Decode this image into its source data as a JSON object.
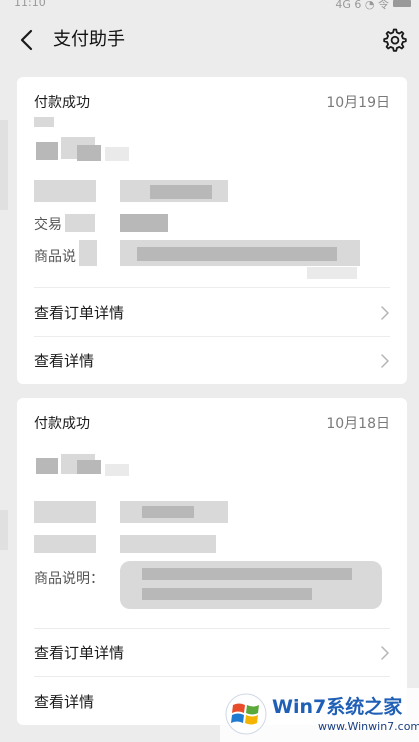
{
  "status_bar": {
    "time": "11:10",
    "indicators": "4G 6 ◔ 令"
  },
  "header": {
    "title": "支付助手"
  },
  "cards": [
    {
      "status": "付款成功",
      "date": "10月19日",
      "labels": {
        "transaction": "交易",
        "product": "商品说"
      },
      "rows": [
        {
          "label": "查看订单详情"
        },
        {
          "label": "查看详情"
        }
      ]
    },
    {
      "status": "付款成功",
      "date": "10月18日",
      "labels": {
        "product": "商品说明："
      },
      "rows": [
        {
          "label": "查看订单详情"
        },
        {
          "label": "查看详情"
        }
      ]
    }
  ],
  "watermark": {
    "title": "Win7系统之家",
    "url": "www.Winwin7.com"
  },
  "icons": {
    "back": "back-arrow-icon",
    "settings": "gear-icon",
    "chevron": "chevron-right-icon",
    "watermark_logo": "windows-logo-icon"
  },
  "colors": {
    "background": "#ececec",
    "card": "#ffffff",
    "text_primary": "#1a1a1a",
    "text_secondary": "#7a7a7a",
    "chevron": "#b5b5b5",
    "watermark_blue": "#1f5fb5"
  }
}
